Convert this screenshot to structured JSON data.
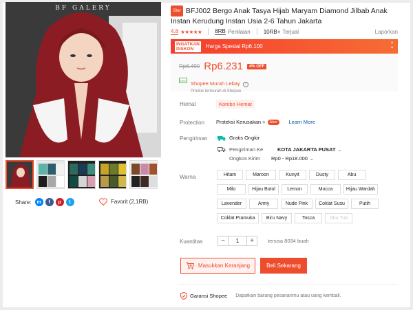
{
  "gallery": {
    "watermark": "BF GALERY",
    "thumb_count": 5
  },
  "share": {
    "label": "Share:",
    "networks": [
      "messenger-icon",
      "facebook-icon",
      "pinterest-icon",
      "twitter-icon"
    ]
  },
  "favorite": {
    "label": "Favorit (2,1RB)"
  },
  "product": {
    "badge": "Star",
    "title": "BFJ002 Bergo Anak Tasya Hijab Maryam Diamond Jilbab Anak Instan Kerudung Instan Usia 2-6 Tahun Jakarta",
    "rating": "4.8",
    "stars_filled": 5,
    "ratings_count": "8RB",
    "ratings_label": "Penilaian",
    "sold_count": "10RB+",
    "sold_label": "Terjual",
    "report_label": "Laporkan"
  },
  "flash": {
    "badge_line1": "INGATKAN",
    "badge_line2": "DISKON",
    "text": "Harga Spesial Rp6.100"
  },
  "price": {
    "original": "Rp6.490",
    "current": "Rp6.231",
    "discount": "4% OFF"
  },
  "seller": {
    "logo_text": "MRH",
    "name": "Shopee Murah Lebay",
    "sub": "Produk termurah di Shopee"
  },
  "hemat": {
    "label": "Hemat",
    "tag": "Kombo Hemat"
  },
  "protection": {
    "label": "Protection",
    "text": "Proteksi Kerusakan +",
    "new_badge": "New",
    "link": "Learn More"
  },
  "shipping": {
    "label": "Pengiriman",
    "free": "Gratis Ongkir",
    "to_label": "Pengiriman Ke",
    "to_value": "KOTA JAKARTA PUSAT",
    "cost_label": "Ongkos Kirim",
    "cost_value": "Rp0 - Rp18.000"
  },
  "variants": {
    "label": "Warna",
    "options": [
      {
        "name": "Hitam",
        "enabled": true
      },
      {
        "name": "Maroon",
        "enabled": true
      },
      {
        "name": "Kunyit",
        "enabled": true
      },
      {
        "name": "Dusty",
        "enabled": true
      },
      {
        "name": "Abu",
        "enabled": true
      },
      {
        "name": "Milo",
        "enabled": true
      },
      {
        "name": "Hijau Botol",
        "enabled": true
      },
      {
        "name": "Lemon",
        "enabled": true
      },
      {
        "name": "Mocca",
        "enabled": true
      },
      {
        "name": "Hijau Wardah",
        "enabled": true
      },
      {
        "name": "Lavender",
        "enabled": true
      },
      {
        "name": "Army",
        "enabled": true
      },
      {
        "name": "Nude Pink",
        "enabled": true
      },
      {
        "name": "Coklat Susu",
        "enabled": true
      },
      {
        "name": "Putih",
        "enabled": true
      },
      {
        "name": "Coklat Pramuka",
        "enabled": true
      },
      {
        "name": "Biru Navy",
        "enabled": true
      },
      {
        "name": "Tosca",
        "enabled": true
      },
      {
        "name": "Abu Tua",
        "enabled": false
      }
    ]
  },
  "quantity": {
    "label": "Kuantitas",
    "minus": "−",
    "value": "1",
    "plus": "+",
    "stock": "tersisa 8034 buah"
  },
  "actions": {
    "cart": "Masukkan Keranjang",
    "buy": "Beli Sekarang"
  },
  "guarantee": {
    "title": "Garansi Shopee",
    "text": "Dapatkan barang pesananmu atau uang kembali."
  },
  "colors": {
    "accent": "#ee4d2d",
    "link": "#0055aa"
  }
}
